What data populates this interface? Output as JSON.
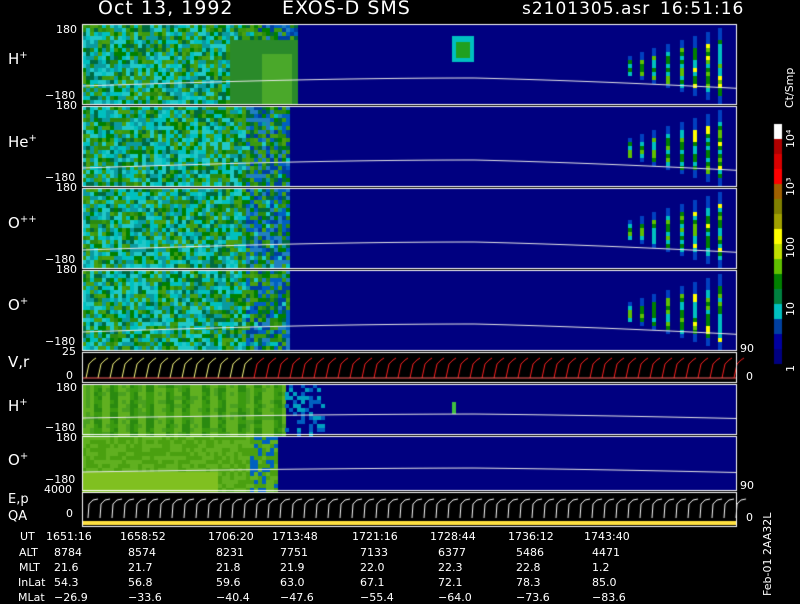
{
  "header": {
    "date": "Oct 13, 1992",
    "instrument": "EXOS-D SMS",
    "filename": "s2101305.asr",
    "time": "16:51:16"
  },
  "panels": [
    {
      "label": "H",
      "sup": "+",
      "ymax": "180",
      "ymin": "−180"
    },
    {
      "label": "He",
      "sup": "+",
      "ymax": "180",
      "ymin": "−180"
    },
    {
      "label": "O",
      "sup": "++",
      "ymax": "180",
      "ymin": "−180"
    },
    {
      "label": "O",
      "sup": "+",
      "ymax": "180",
      "ymin": "−180"
    },
    {
      "label": "V,r",
      "sup": "",
      "ymax": "25",
      "ymin": "0",
      "right_top": "90",
      "right_bottom": "0"
    },
    {
      "label": "H",
      "sup": "+",
      "ymax": "180",
      "ymin": "−180"
    },
    {
      "label": "O",
      "sup": "+",
      "ymax": "180",
      "ymin": "−180",
      "right_bottom": "90"
    },
    {
      "label": "E,p",
      "sublabel": "QA",
      "ymax": "4000",
      "ymin": "0",
      "right_bottom": "0"
    }
  ],
  "colorbar": {
    "unit": "Ct/Smp",
    "labels": [
      "10⁴",
      "10³",
      "100",
      "10",
      "1"
    ],
    "colors": [
      "#ffffff",
      "#b00000",
      "#d80000",
      "#ff0000",
      "#a06000",
      "#808000",
      "#a0a000",
      "#ffff00",
      "#c0e000",
      "#60c000",
      "#008000",
      "#008040",
      "#00c0c0",
      "#0040a0",
      "#0000a0",
      "#000080"
    ]
  },
  "footer": {
    "rows": [
      {
        "name": "UT",
        "values": [
          "1651:16",
          "1658:52",
          "1706:20",
          "1713:48",
          "1721:16",
          "1728:44",
          "1736:12",
          "1743:40"
        ]
      },
      {
        "name": "ALT",
        "values": [
          "8784",
          "8574",
          "8231",
          "7751",
          "7133",
          "6377",
          "5486",
          "4471"
        ]
      },
      {
        "name": "MLT",
        "values": [
          "21.6",
          "21.7",
          "21.8",
          "21.9",
          "22.0",
          "22.3",
          "22.8",
          "1.2"
        ]
      },
      {
        "name": "InLat",
        "values": [
          "54.3",
          "56.8",
          "59.6",
          "63.0",
          "67.1",
          "72.1",
          "78.3",
          "85.0"
        ]
      },
      {
        "name": "MLat",
        "values": [
          "−26.9",
          "−33.6",
          "−40.4",
          "−47.6",
          "−55.4",
          "−64.0",
          "−73.6",
          "−83.6"
        ]
      }
    ],
    "side_label": "Feb-01 2AA32L"
  },
  "chart_data": {
    "type": "heatmap",
    "title": "Oct 13, 1992   EXOS-D SMS   s2101305.asr   16:51:16",
    "x_axis": {
      "label": "UT",
      "ticks": [
        "1651:16",
        "1658:52",
        "1706:20",
        "1713:48",
        "1721:16",
        "1728:44",
        "1736:12",
        "1743:40"
      ]
    },
    "colorscale": {
      "unit": "Ct/Smp",
      "min": 1,
      "max": 10000,
      "scale": "log"
    },
    "panels": [
      "H+",
      "He+",
      "O++",
      "O+",
      "V,r",
      "H+",
      "O+",
      "E,p / QA"
    ],
    "pitch_angle_range": [
      -180,
      180
    ]
  }
}
